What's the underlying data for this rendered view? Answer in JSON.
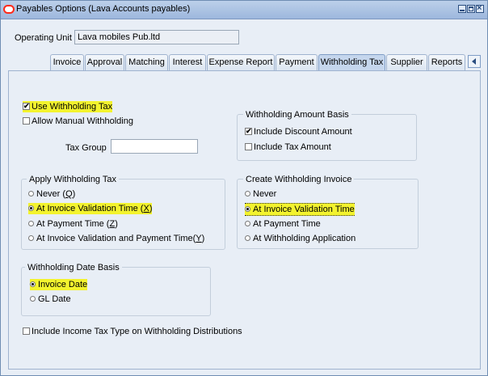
{
  "window": {
    "title": "Payables Options (Lava Accounts payables)"
  },
  "operating_unit": {
    "label": "Operating Unit",
    "value": "Lava mobiles Pub.ltd"
  },
  "tabs": [
    {
      "label": "Invoice"
    },
    {
      "label": "Approval"
    },
    {
      "label": "Matching"
    },
    {
      "label": "Interest"
    },
    {
      "label": "Expense Report"
    },
    {
      "label": "Payment"
    },
    {
      "label": "Withholding Tax",
      "active": true
    },
    {
      "label": "Supplier"
    },
    {
      "label": "Reports"
    }
  ],
  "withholding": {
    "use_withholding_tax": {
      "label": "Use Withholding Tax",
      "checked": true
    },
    "allow_manual_withholding": {
      "label": "Allow Manual Withholding",
      "checked": false
    },
    "tax_group": {
      "label": "Tax Group",
      "value": ""
    }
  },
  "amount_basis": {
    "title": "Withholding Amount Basis",
    "include_discount": {
      "label": "Include Discount Amount",
      "checked": true
    },
    "include_tax": {
      "label": "Include Tax Amount",
      "checked": false
    }
  },
  "apply_withholding": {
    "title": "Apply Withholding Tax",
    "options": [
      {
        "text": "Never (",
        "key": "Q",
        "suffix": ")",
        "selected": false
      },
      {
        "text": "At Invoice Validation Time (",
        "key": "X",
        "suffix": ")",
        "selected": true
      },
      {
        "text": "At Payment Time (",
        "key": "Z",
        "suffix": ")",
        "selected": false
      },
      {
        "text": "At Invoice Validation and Payment Time(",
        "key": "Y",
        "suffix": ")",
        "selected": false
      }
    ]
  },
  "create_invoice": {
    "title": "Create Withholding Invoice",
    "options": [
      {
        "text": "Never",
        "selected": false
      },
      {
        "text": "At Invoice Validation Time",
        "selected": true
      },
      {
        "text": "At Payment Time",
        "selected": false
      },
      {
        "text": "At Withholding Application",
        "selected": false
      }
    ]
  },
  "date_basis": {
    "title": "Withholding Date Basis",
    "options": [
      {
        "text": "Invoice Date",
        "selected": true
      },
      {
        "text": "GL Date",
        "selected": false
      }
    ]
  },
  "income_tax_type": {
    "label": "Include Income Tax Type on Withholding Distributions",
    "checked": false
  },
  "colors": {
    "highlight": "#f3f32e",
    "title_bar": "#9db7dd",
    "panel_bg": "#e8eef6"
  }
}
